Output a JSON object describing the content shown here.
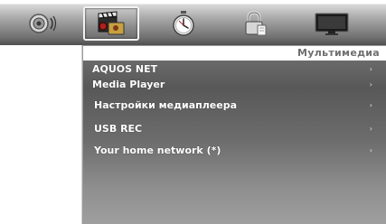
{
  "tabs": [
    {
      "icon": "speaker-icon"
    },
    {
      "icon": "media-clapperboard-icon",
      "active": true
    },
    {
      "icon": "clock-icon"
    },
    {
      "icon": "lock-icon"
    },
    {
      "icon": "tv-icon"
    }
  ],
  "header": {
    "title": "Мультимедиа"
  },
  "menu": {
    "arrow": "›",
    "items": [
      {
        "label": "AQUOS NET"
      },
      {
        "label": "Media Player"
      },
      {
        "label": "Настройки медиаплеера"
      },
      {
        "label": "USB REC"
      },
      {
        "label": "Your home network (*)"
      }
    ]
  },
  "colors": {
    "header_text": "#6f6f6f",
    "menu_text": "#ffffff",
    "panel_bg": "#5c5c5c"
  }
}
